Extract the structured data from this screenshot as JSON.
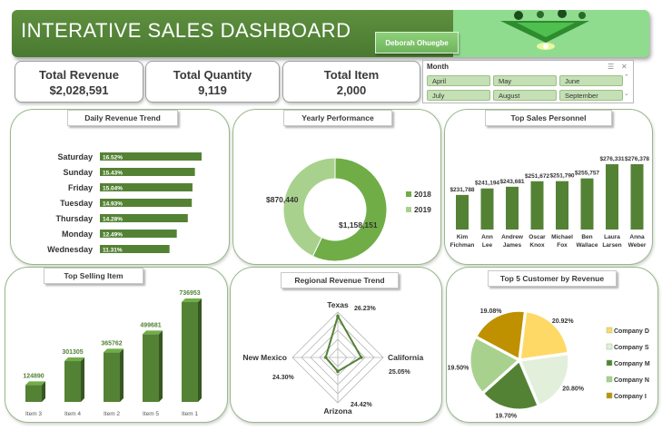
{
  "header": {
    "title": "INTERATIVE SALES DASHBOARD",
    "user_button": "Deborah Ohuegbe"
  },
  "kpis": [
    {
      "label": "Total Revenue",
      "value": "$2,028,591"
    },
    {
      "label": "Total Quantity",
      "value": "9,119"
    },
    {
      "label": "Total Item",
      "value": "2,000"
    }
  ],
  "slicer": {
    "title": "Month",
    "items": [
      "April",
      "May",
      "June",
      "July",
      "August",
      "September"
    ]
  },
  "colors": {
    "primary": "#548235",
    "mid": "#70ad47",
    "light": "#a9d18e",
    "pale": "#e2efda",
    "gold": "#bf9000",
    "yellow": "#ffd966",
    "header": "#5e8f3f"
  },
  "panels": {
    "daily": {
      "title": "Daily Revenue Trend"
    },
    "yearly": {
      "title": "Yearly Performance"
    },
    "personnel": {
      "title": "Top Sales Personnel"
    },
    "selling": {
      "title": "Top Selling Item"
    },
    "regional": {
      "title": "Regional Revenue Trend"
    },
    "customers": {
      "title": "Top 5 Customer by Revenue"
    }
  },
  "chart_data": [
    {
      "id": "daily",
      "type": "bar",
      "orientation": "horizontal",
      "categories": [
        "Saturday",
        "Sunday",
        "Friday",
        "Tuesday",
        "Thursday",
        "Monday",
        "Wednesday"
      ],
      "values": [
        16.52,
        15.43,
        15.04,
        14.93,
        14.28,
        12.49,
        11.31
      ],
      "labels": [
        "16.52%",
        "15.43%",
        "15.04%",
        "14.93%",
        "14.28%",
        "12.49%",
        "11.31%"
      ]
    },
    {
      "id": "yearly",
      "type": "pie",
      "donut": true,
      "categories": [
        "2018",
        "2019"
      ],
      "values": [
        1158151,
        870440
      ],
      "labels": [
        "$1,158,151",
        "$870,440"
      ],
      "legend": "right"
    },
    {
      "id": "personnel",
      "type": "bar",
      "categories": [
        "Kim Fichman",
        "Ann Lee",
        "Andrew James",
        "Oscar Knox",
        "Michael Fox",
        "Ben Wallace",
        "Laura Larsen",
        "Anna Weber"
      ],
      "category_lines": [
        [
          "Kim",
          "Fichman"
        ],
        [
          "Ann",
          "Lee"
        ],
        [
          "Andrew",
          "James"
        ],
        [
          "Oscar",
          "Knox"
        ],
        [
          "Michael",
          "Fox"
        ],
        [
          "Ben",
          "Wallace"
        ],
        [
          "Laura",
          "Larsen"
        ],
        [
          "Anna",
          "Weber"
        ]
      ],
      "values": [
        231788,
        241194,
        243681,
        251672,
        251790,
        255757,
        276331,
        276378
      ],
      "labels": [
        "$231,788",
        "$241,194",
        "$243,681",
        "$251,672",
        "$251,790",
        "$255,757",
        "$276,331",
        "$276,378"
      ]
    },
    {
      "id": "selling",
      "type": "bar",
      "style": "3d-column",
      "categories": [
        "Item 3",
        "Item 4",
        "Item 2",
        "Item 5",
        "Item 1"
      ],
      "values": [
        124890,
        301305,
        365762,
        499681,
        736953
      ],
      "labels": [
        "124890",
        "301305",
        "365762",
        "499681",
        "736953"
      ]
    },
    {
      "id": "regional",
      "type": "radar",
      "categories": [
        "Texas",
        "California",
        "Arizona",
        "New Mexico"
      ],
      "values": [
        26.23,
        25.05,
        24.42,
        24.3
      ],
      "labels": [
        "26.23%",
        "25.05%",
        "24.42%",
        "24.30%"
      ]
    },
    {
      "id": "customers",
      "type": "pie",
      "categories": [
        "Company D",
        "Company S",
        "Company M",
        "Company N",
        "Company I"
      ],
      "values": [
        20.92,
        20.8,
        19.7,
        19.5,
        19.08
      ],
      "labels": [
        "20.92%",
        "20.80%",
        "19.70%",
        "19.50%",
        "19.08%"
      ],
      "legend": "right"
    }
  ]
}
